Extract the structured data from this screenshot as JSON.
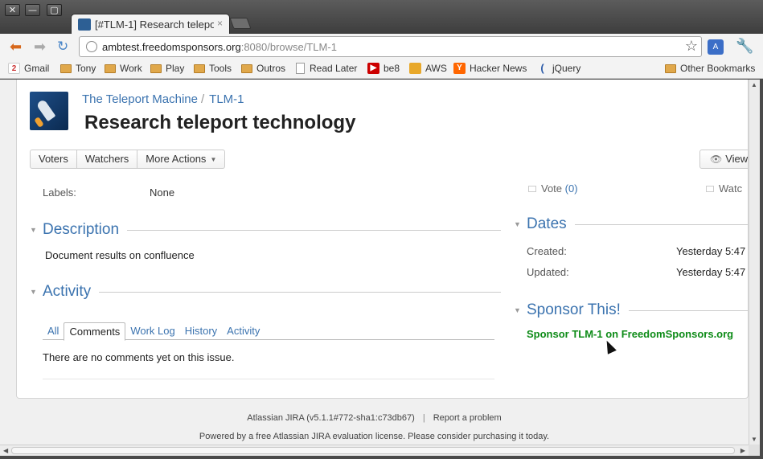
{
  "window": {
    "close_glyph": "✕",
    "min_glyph": "—",
    "max_glyph": "▢"
  },
  "tab": {
    "title": "[#TLM-1] Research telepo",
    "close_glyph": "×"
  },
  "toolbar": {
    "back_glyph": "⬅",
    "forward_glyph": "➡",
    "reload_glyph": "↻",
    "url_host": "ambtest.freedomsponsors.org",
    "url_rest": ":8080/browse/TLM-1",
    "star_glyph": "☆",
    "translate_glyph": "A",
    "wrench_glyph": "🔧"
  },
  "bookmarks": [
    {
      "label": "Gmail",
      "icon": "gmail-icon"
    },
    {
      "label": "Tony",
      "icon": "folder-icon"
    },
    {
      "label": "Work",
      "icon": "folder-icon"
    },
    {
      "label": "Play",
      "icon": "folder-icon"
    },
    {
      "label": "Tools",
      "icon": "folder-icon"
    },
    {
      "label": "Outros",
      "icon": "folder-icon"
    },
    {
      "label": "Read Later",
      "icon": "page-icon"
    },
    {
      "label": "be8",
      "icon": "youtube-icon"
    },
    {
      "label": "AWS",
      "icon": "aws-icon"
    },
    {
      "label": "Hacker News",
      "icon": "hacker-news-icon"
    },
    {
      "label": "jQuery",
      "icon": "jquery-icon"
    }
  ],
  "other_bookmarks": "Other Bookmarks",
  "gmail_count": "2",
  "issue": {
    "project": "The Teleport Machine",
    "crumb_sep": "/",
    "key": "TLM-1",
    "summary": "Research teleport technology"
  },
  "ops": {
    "voters": "Voters",
    "watchers": "Watchers",
    "more_actions": "More Actions",
    "more_caret": "▼",
    "view": "View",
    "view_glyph": "👁"
  },
  "details": {
    "labels_label": "Labels:",
    "labels_value": "None"
  },
  "description": {
    "heading": "Description",
    "toggle_glyph": "▼",
    "text": "Document results on confluence"
  },
  "activity": {
    "heading": "Activity",
    "toggle_glyph": "▼",
    "tabs": [
      "All",
      "Comments",
      "Work Log",
      "History",
      "Activity"
    ],
    "active_tab": "Comments",
    "empty_text": "There are no comments yet on this issue."
  },
  "people": {
    "vote_label": "Vote",
    "vote_count": "(0)",
    "watch_label": "Watc"
  },
  "dates": {
    "heading": "Dates",
    "toggle_glyph": "▼",
    "created_label": "Created:",
    "created_value": "Yesterday 5:47",
    "updated_label": "Updated:",
    "updated_value": "Yesterday 5:47"
  },
  "sponsor": {
    "heading": "Sponsor This!",
    "toggle_glyph": "▼",
    "link": "Sponsor TLM-1 on FreedomSponsors.org"
  },
  "footer": {
    "version": "Atlassian JIRA (v5.1.1#772-sha1:c73db67)",
    "sep": "|",
    "report": "Report a problem",
    "license": "Powered by a free Atlassian JIRA evaluation license. Please consider purchasing it today."
  },
  "scroll": {
    "up": "▲",
    "down": "▼",
    "left": "◀",
    "right": "▶"
  }
}
